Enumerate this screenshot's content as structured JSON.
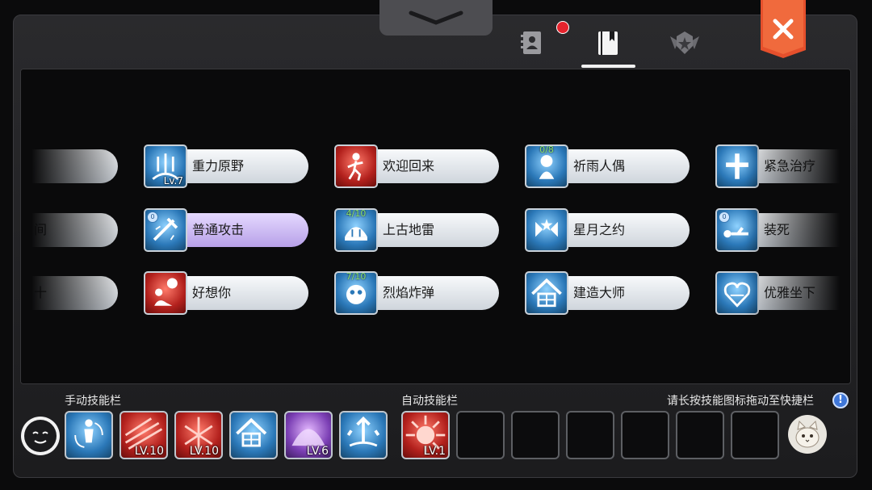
{
  "tabs": [
    {
      "name": "contacts-icon"
    },
    {
      "name": "book-icon",
      "selected": true
    },
    {
      "name": "emblem-icon"
    }
  ],
  "close_icon": "close-icon",
  "skills": [
    {
      "label": "重力原野",
      "icon": "gravity-field-icon",
      "color": "blue",
      "level": "Lv.7",
      "progress": "",
      "badge": ""
    },
    {
      "label": "欢迎回来",
      "icon": "welcome-back-icon",
      "color": "red",
      "level": "",
      "progress": "",
      "badge": ""
    },
    {
      "label": "祈雨人偶",
      "icon": "rain-doll-icon",
      "color": "blue",
      "level": "",
      "progress": "0/8",
      "badge": ""
    },
    {
      "label": "紧急治疗",
      "icon": "emergency-heal-icon",
      "color": "blue",
      "level": "",
      "progress": "",
      "badge": ""
    },
    {
      "label": "普通攻击",
      "icon": "normal-attack-icon",
      "color": "blue",
      "level": "",
      "progress": "",
      "badge": "0",
      "selected": true
    },
    {
      "label": "上古地雷",
      "icon": "ancient-mine-icon",
      "color": "blue",
      "level": "",
      "progress": "4/10",
      "badge": ""
    },
    {
      "label": "星月之约",
      "icon": "star-moon-icon",
      "color": "blue",
      "level": "",
      "progress": "",
      "badge": ""
    },
    {
      "label": "装死",
      "icon": "play-dead-icon",
      "color": "blue",
      "level": "",
      "progress": "",
      "badge": "0"
    },
    {
      "label": "好想你",
      "icon": "miss-you-icon",
      "color": "red",
      "level": "",
      "progress": "",
      "badge": ""
    },
    {
      "label": "烈焰炸弹",
      "icon": "flame-bomb-icon",
      "color": "blue",
      "level": "",
      "progress": "7/10",
      "badge": ""
    },
    {
      "label": "建造大师",
      "icon": "build-master-icon",
      "color": "blue",
      "level": "",
      "progress": "",
      "badge": ""
    },
    {
      "label": "优雅坐下",
      "icon": "elegant-sit-icon",
      "color": "blue",
      "level": "",
      "progress": "",
      "badge": ""
    }
  ],
  "partial_left": [
    "",
    "间",
    "十"
  ],
  "manual_bar": {
    "label": "手动技能栏",
    "slots": [
      {
        "icon": "rotate-person-icon",
        "color": "blue",
        "level": ""
      },
      {
        "icon": "red-slash-icon",
        "color": "red",
        "level": "LV.10"
      },
      {
        "icon": "red-burst-icon",
        "color": "red",
        "level": "LV.10"
      },
      {
        "icon": "build-master-icon",
        "color": "blue",
        "level": ""
      },
      {
        "icon": "purple-dome-icon",
        "color": "purple",
        "level": "LV.6"
      },
      {
        "icon": "launch-arrows-icon",
        "color": "blue",
        "level": ""
      }
    ]
  },
  "auto_bar": {
    "label": "自动技能栏",
    "slots": [
      {
        "icon": "red-explosion-icon",
        "color": "red",
        "level": "LV.1"
      },
      {
        "icon": "",
        "color": "",
        "level": ""
      },
      {
        "icon": "",
        "color": "",
        "level": ""
      },
      {
        "icon": "",
        "color": "",
        "level": ""
      },
      {
        "icon": "",
        "color": "",
        "level": ""
      },
      {
        "icon": "",
        "color": "",
        "level": ""
      },
      {
        "icon": "",
        "color": "",
        "level": ""
      }
    ]
  },
  "hint": "请长按技能图标拖动至快捷栏"
}
